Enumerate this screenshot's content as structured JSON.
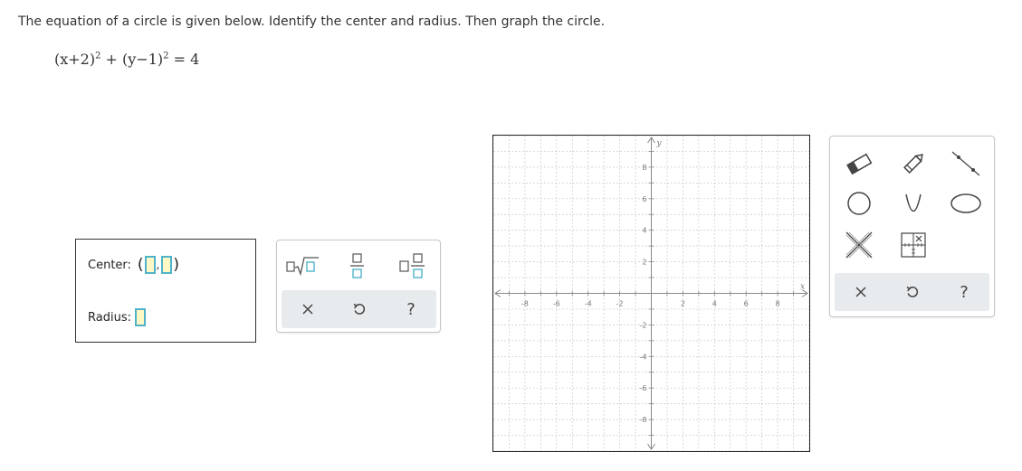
{
  "instructions": "The equation of a circle is given below. Identify the center and radius. Then graph the circle.",
  "equation": {
    "p1": "(x+2)",
    "exp1": "2",
    "plus": " + ",
    "p2": "(y−1)",
    "exp2": "2",
    "rhs": " = 4"
  },
  "answer": {
    "center_label": "Center:",
    "open_paren": "(",
    "comma": ",",
    "close_paren": ")",
    "radius_label": "Radius:",
    "center_x_value": "",
    "center_y_value": "",
    "radius_value": ""
  },
  "keypad": {
    "buttons": [
      "square-root-icon",
      "fraction-icon",
      "mixed-number-icon"
    ],
    "actions": [
      "clear-icon",
      "undo-icon",
      "help-icon"
    ],
    "help_label": "?"
  },
  "graph": {
    "x_axis_label": "x",
    "y_axis_label": "y",
    "x_ticks": [
      "-8",
      "-6",
      "-4",
      "-2",
      "2",
      "4",
      "6",
      "8"
    ],
    "y_ticks": [
      "8",
      "6",
      "4",
      "2",
      "-2",
      "-4",
      "-6",
      "-8"
    ]
  },
  "tools": {
    "items": [
      "eraser-icon",
      "pencil-icon",
      "line-icon",
      "circle-icon",
      "parabola-icon",
      "ellipse-icon",
      "x-mark-icon",
      "grid-icon"
    ],
    "actions": [
      "clear-icon",
      "undo-icon",
      "help-icon"
    ],
    "help_label": "?"
  },
  "colors": {
    "accent": "#4fb3c9",
    "blank_fill": "#fff8c4",
    "button_bar": "#e8ebee",
    "grid_line": "#c8c8c8",
    "axis": "#888888"
  }
}
